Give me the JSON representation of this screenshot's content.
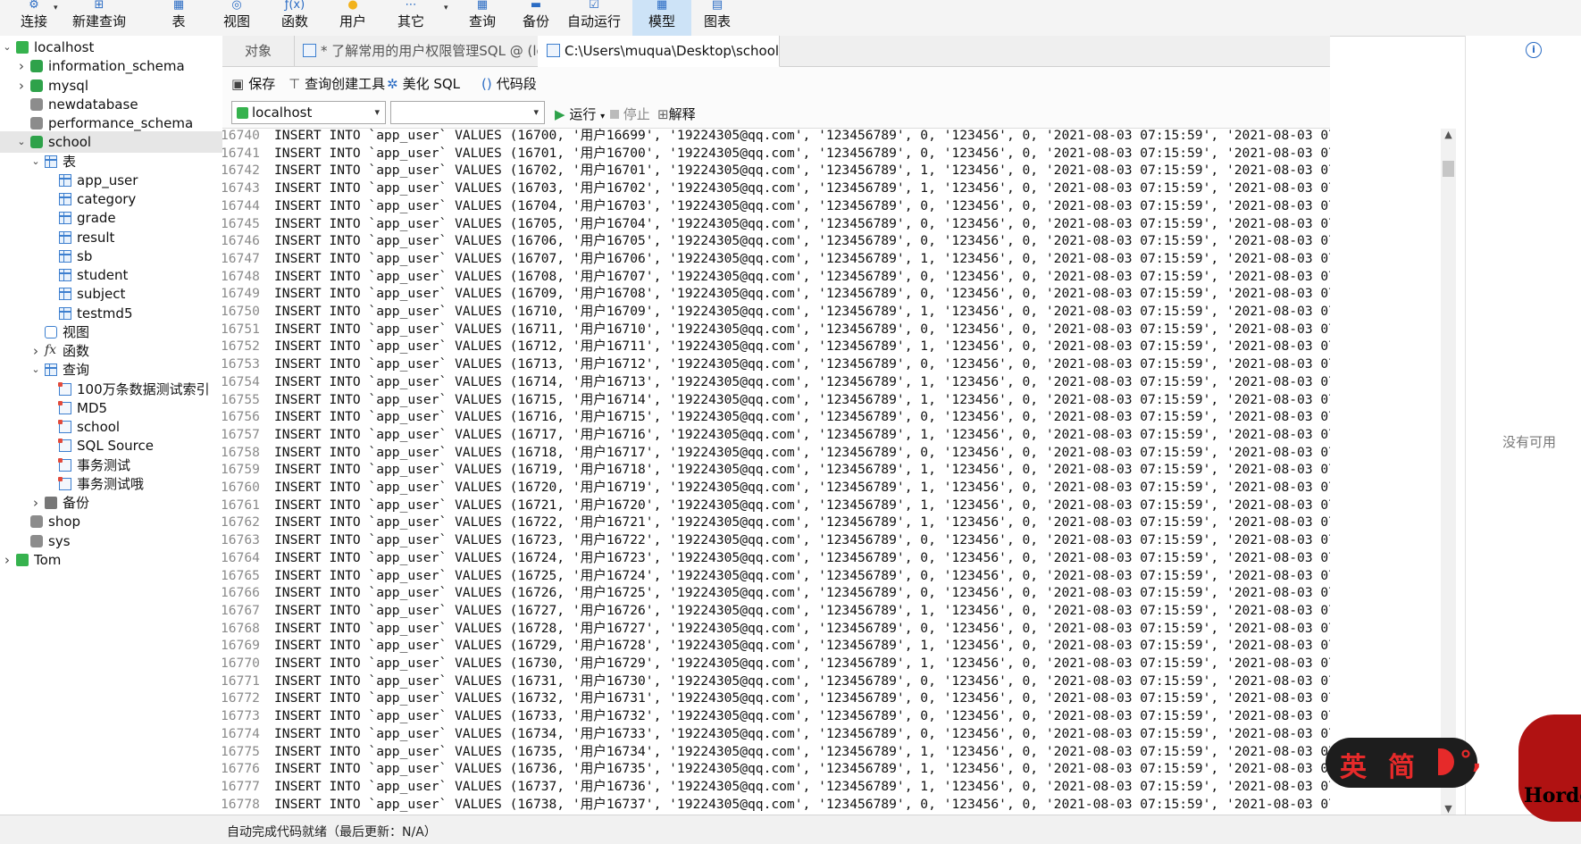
{
  "toolbar": {
    "items": [
      {
        "label": "连接",
        "icon": "connection-icon"
      },
      {
        "label": "新建查询",
        "icon": "new-query-icon"
      },
      {
        "label": "表",
        "icon": "table-icon"
      },
      {
        "label": "视图",
        "icon": "view-icon"
      },
      {
        "label": "函数",
        "icon": "function-icon"
      },
      {
        "label": "用户",
        "icon": "user-icon"
      },
      {
        "label": "其它",
        "icon": "other-icon"
      },
      {
        "label": "查询",
        "icon": "query-icon"
      },
      {
        "label": "备份",
        "icon": "backup-icon"
      },
      {
        "label": "自动运行",
        "icon": "auto-run-icon"
      },
      {
        "label": "模型",
        "icon": "model-icon"
      },
      {
        "label": "图表",
        "icon": "chart-icon"
      }
    ],
    "active": "模型"
  },
  "tree": [
    {
      "label": "localhost",
      "type": "connection",
      "expanded": true
    },
    {
      "label": "information_schema",
      "type": "database",
      "expanded": false
    },
    {
      "label": "mysql",
      "type": "database",
      "expanded": false
    },
    {
      "label": "newdatabase",
      "type": "database-closed"
    },
    {
      "label": "performance_schema",
      "type": "database-closed"
    },
    {
      "label": "school",
      "type": "database",
      "expanded": true,
      "selected": true
    },
    {
      "label": "表",
      "type": "folder-tables",
      "expanded": true
    },
    {
      "label": "app_user",
      "type": "table"
    },
    {
      "label": "category",
      "type": "table"
    },
    {
      "label": "grade",
      "type": "table"
    },
    {
      "label": "result",
      "type": "table"
    },
    {
      "label": "sb",
      "type": "table"
    },
    {
      "label": "student",
      "type": "table"
    },
    {
      "label": "subject",
      "type": "table"
    },
    {
      "label": "testmd5",
      "type": "table"
    },
    {
      "label": "视图",
      "type": "folder-views"
    },
    {
      "label": "函数",
      "type": "folder-functions",
      "expanded": false
    },
    {
      "label": "查询",
      "type": "folder-queries",
      "expanded": true
    },
    {
      "label": "100万条数据测试索引",
      "type": "query"
    },
    {
      "label": "MD5",
      "type": "query"
    },
    {
      "label": "school",
      "type": "query"
    },
    {
      "label": "SQL Source",
      "type": "query"
    },
    {
      "label": "事务测试",
      "type": "query"
    },
    {
      "label": "事务测试哦",
      "type": "query"
    },
    {
      "label": "备份",
      "type": "folder-backup",
      "expanded": false
    },
    {
      "label": "shop",
      "type": "database-closed"
    },
    {
      "label": "sys",
      "type": "database-closed"
    },
    {
      "label": "Tom",
      "type": "connection",
      "expanded": false
    }
  ],
  "tabs": {
    "objects": "对象",
    "tab1": "* 了解常用的用户权限管理SQL @ (loc...",
    "tab2": "C:\\Users\\muqua\\Desktop\\school.sql..."
  },
  "editor_toolbar": {
    "save": "保存",
    "query_builder": "查询创建工具",
    "beautify": "美化 SQL",
    "snippet": "代码段",
    "connection_value": "localhost",
    "database_value": "",
    "run": "运行",
    "stop": "停止",
    "explain": "解释"
  },
  "editor": {
    "lines": [
      {
        "num": "16740",
        "id": "16700",
        "name": "用户16699",
        "flag": "0"
      },
      {
        "num": "16741",
        "id": "16701",
        "name": "用户16700",
        "flag": "0"
      },
      {
        "num": "16742",
        "id": "16702",
        "name": "用户16701",
        "flag": "1"
      },
      {
        "num": "16743",
        "id": "16703",
        "name": "用户16702",
        "flag": "1"
      },
      {
        "num": "16744",
        "id": "16704",
        "name": "用户16703",
        "flag": "0"
      },
      {
        "num": "16745",
        "id": "16705",
        "name": "用户16704",
        "flag": "0"
      },
      {
        "num": "16746",
        "id": "16706",
        "name": "用户16705",
        "flag": "0"
      },
      {
        "num": "16747",
        "id": "16707",
        "name": "用户16706",
        "flag": "1"
      },
      {
        "num": "16748",
        "id": "16708",
        "name": "用户16707",
        "flag": "0"
      },
      {
        "num": "16749",
        "id": "16709",
        "name": "用户16708",
        "flag": "0"
      },
      {
        "num": "16750",
        "id": "16710",
        "name": "用户16709",
        "flag": "1"
      },
      {
        "num": "16751",
        "id": "16711",
        "name": "用户16710",
        "flag": "0"
      },
      {
        "num": "16752",
        "id": "16712",
        "name": "用户16711",
        "flag": "1"
      },
      {
        "num": "16753",
        "id": "16713",
        "name": "用户16712",
        "flag": "0"
      },
      {
        "num": "16754",
        "id": "16714",
        "name": "用户16713",
        "flag": "1"
      },
      {
        "num": "16755",
        "id": "16715",
        "name": "用户16714",
        "flag": "1"
      },
      {
        "num": "16756",
        "id": "16716",
        "name": "用户16715",
        "flag": "0"
      },
      {
        "num": "16757",
        "id": "16717",
        "name": "用户16716",
        "flag": "1"
      },
      {
        "num": "16758",
        "id": "16718",
        "name": "用户16717",
        "flag": "0"
      },
      {
        "num": "16759",
        "id": "16719",
        "name": "用户16718",
        "flag": "1"
      },
      {
        "num": "16760",
        "id": "16720",
        "name": "用户16719",
        "flag": "1"
      },
      {
        "num": "16761",
        "id": "16721",
        "name": "用户16720",
        "flag": "1"
      },
      {
        "num": "16762",
        "id": "16722",
        "name": "用户16721",
        "flag": "1"
      },
      {
        "num": "16763",
        "id": "16723",
        "name": "用户16722",
        "flag": "0"
      },
      {
        "num": "16764",
        "id": "16724",
        "name": "用户16723",
        "flag": "0"
      },
      {
        "num": "16765",
        "id": "16725",
        "name": "用户16724",
        "flag": "0"
      },
      {
        "num": "16766",
        "id": "16726",
        "name": "用户16725",
        "flag": "0"
      },
      {
        "num": "16767",
        "id": "16727",
        "name": "用户16726",
        "flag": "1"
      },
      {
        "num": "16768",
        "id": "16728",
        "name": "用户16727",
        "flag": "0"
      },
      {
        "num": "16769",
        "id": "16729",
        "name": "用户16728",
        "flag": "1"
      },
      {
        "num": "16770",
        "id": "16730",
        "name": "用户16729",
        "flag": "1"
      },
      {
        "num": "16771",
        "id": "16731",
        "name": "用户16730",
        "flag": "0"
      },
      {
        "num": "16772",
        "id": "16732",
        "name": "用户16731",
        "flag": "0"
      },
      {
        "num": "16773",
        "id": "16733",
        "name": "用户16732",
        "flag": "0"
      },
      {
        "num": "16774",
        "id": "16734",
        "name": "用户16733",
        "flag": "0"
      },
      {
        "num": "16775",
        "id": "16735",
        "name": "用户16734",
        "flag": "1"
      },
      {
        "num": "16776",
        "id": "16736",
        "name": "用户16735",
        "flag": "1"
      },
      {
        "num": "16777",
        "id": "16737",
        "name": "用户16736",
        "flag": "1"
      },
      {
        "num": "16778",
        "id": "16738",
        "name": "用户16737",
        "flag": "0"
      }
    ],
    "email": "19224305@qq.com",
    "password": "123456789",
    "code": "123456",
    "timestamp": "2021-08-03 07:15:59"
  },
  "right_panel": {
    "no_available": "没有可用"
  },
  "status": {
    "text": "自动完成代码就绪（最后更新：N/A）"
  },
  "ime": {
    "mode_a": "英",
    "mode_b": "简",
    "brand": "Hordo"
  },
  "colors": {
    "accent": "#2b6cc4",
    "db_green": "#2ea24a",
    "active_tab": "#cde3f7",
    "ime_red": "#e62a2a"
  }
}
